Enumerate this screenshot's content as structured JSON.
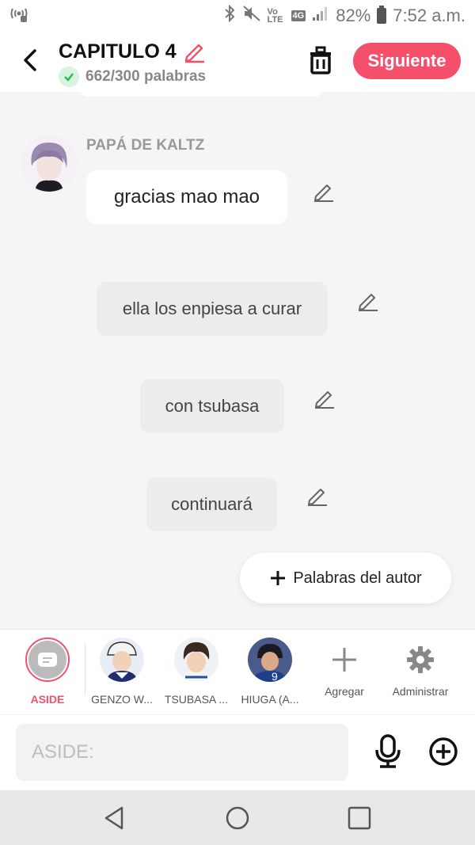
{
  "status_bar": {
    "battery": "82%",
    "time": "7:52 a.m.",
    "network_small": "Vo LTE",
    "network_4g": "4G"
  },
  "header": {
    "title": "CAPITULO 4",
    "word_count": "662/300 palabras",
    "next_label": "Siguiente",
    "accent_color": "#f5506b"
  },
  "messages": {
    "speaker": "PAPÁ DE KALTZ",
    "first": "gracias mao mao",
    "asides": [
      "ella los enpiesa a curar",
      "con tsubasa",
      "continuará"
    ]
  },
  "author_button": {
    "label": "Palabras del autor"
  },
  "characters": [
    {
      "label": "ASIDE",
      "active": true
    },
    {
      "label": "GENZO W..."
    },
    {
      "label": "TSUBASA ..."
    },
    {
      "label": "HIUGA (A..."
    },
    {
      "label": "Agregar"
    },
    {
      "label": "Administrar"
    }
  ],
  "input": {
    "placeholder": "ASIDE:"
  }
}
